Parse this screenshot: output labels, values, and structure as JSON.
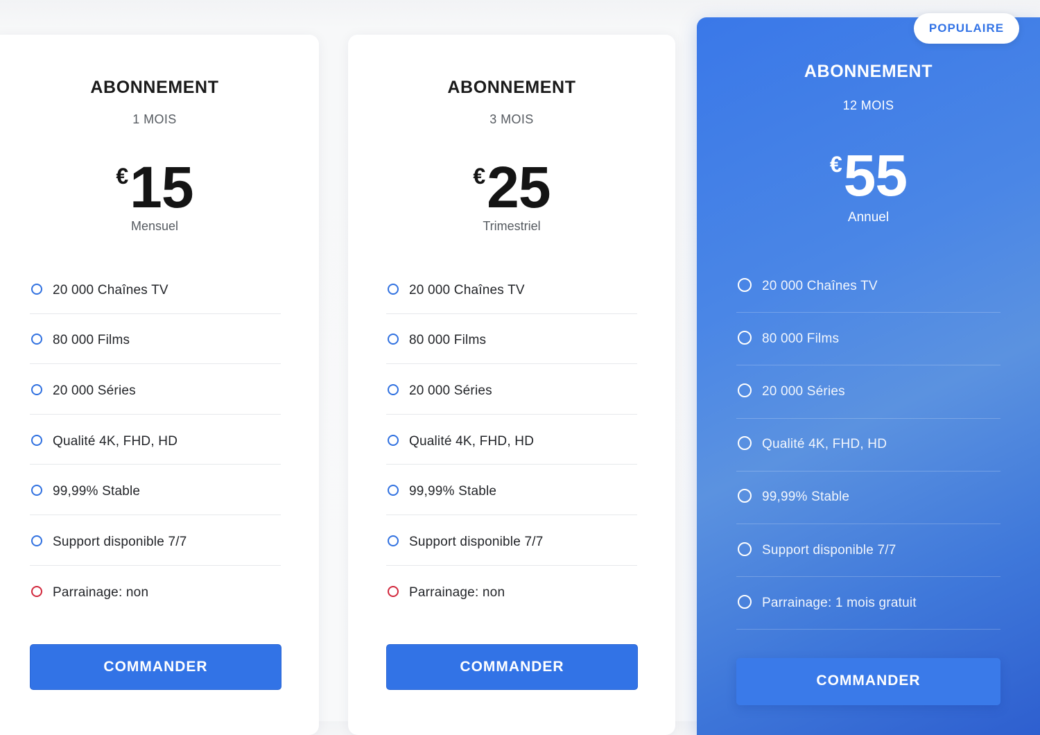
{
  "plans": [
    {
      "title": "ABONNEMENT",
      "duration": "1 MOIS",
      "currency": "€",
      "price": "15",
      "billing": "Mensuel",
      "features": [
        {
          "label": "20 000 Chaînes TV",
          "status": "included"
        },
        {
          "label": "80 000 Films",
          "status": "included"
        },
        {
          "label": "20 000 Séries",
          "status": "included"
        },
        {
          "label": "Qualité 4K, FHD, HD",
          "status": "included"
        },
        {
          "label": "99,99% Stable",
          "status": "included"
        },
        {
          "label": "Support disponible 7/7",
          "status": "included"
        },
        {
          "label": "Parrainage: non",
          "status": "excluded"
        }
      ],
      "button_label": "COMMANDER"
    },
    {
      "title": "ABONNEMENT",
      "duration": "3 MOIS",
      "currency": "€",
      "price": "25",
      "billing": "Trimestriel",
      "features": [
        {
          "label": "20 000 Chaînes TV",
          "status": "included"
        },
        {
          "label": "80 000 Films",
          "status": "included"
        },
        {
          "label": "20 000 Séries",
          "status": "included"
        },
        {
          "label": "Qualité 4K, FHD, HD",
          "status": "included"
        },
        {
          "label": "99,99% Stable",
          "status": "included"
        },
        {
          "label": "Support disponible 7/7",
          "status": "included"
        },
        {
          "label": "Parrainage: non",
          "status": "excluded"
        }
      ],
      "button_label": "COMMANDER"
    },
    {
      "badge": "POPULAIRE",
      "title": "ABONNEMENT",
      "duration": "12 MOIS",
      "currency": "€",
      "price": "55",
      "billing": "Annuel",
      "features": [
        {
          "label": "20 000 Chaînes TV",
          "status": "included"
        },
        {
          "label": "80 000 Films",
          "status": "included"
        },
        {
          "label": "20 000 Séries",
          "status": "included"
        },
        {
          "label": "Qualité 4K, FHD, HD",
          "status": "included"
        },
        {
          "label": "99,99% Stable",
          "status": "included"
        },
        {
          "label": "Support disponible 7/7",
          "status": "included"
        },
        {
          "label": "Parrainage: 1 mois gratuit",
          "status": "included"
        }
      ],
      "button_label": "COMMANDER"
    }
  ],
  "colors": {
    "accent": "#3273e6",
    "excluded_ring": "#d1263b",
    "highlight_gradient_start": "#3a78e8",
    "highlight_gradient_end": "#2e5fcf",
    "badge_text": "#3273e6"
  },
  "icons": {
    "included": "circle-outline-icon",
    "excluded": "circle-outline-red-icon"
  }
}
